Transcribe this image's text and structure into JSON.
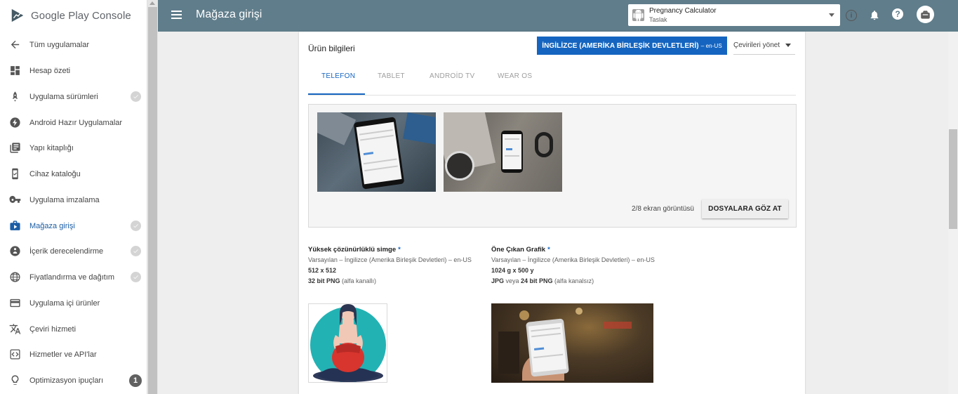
{
  "brand": {
    "name": "Google Play Console"
  },
  "sidebar": {
    "items": [
      {
        "label": "Tüm uygulamalar",
        "icon": "arrow-left-icon",
        "state": "none"
      },
      {
        "label": "Hesap özeti",
        "icon": "dashboard-icon",
        "state": "none"
      },
      {
        "label": "Uygulama sürümleri",
        "icon": "rocket-icon",
        "state": "check"
      },
      {
        "label": "Android Hazır Uygulamalar",
        "icon": "bolt-icon",
        "state": "none"
      },
      {
        "label": "Yapı kitaplığı",
        "icon": "library-icon",
        "state": "none"
      },
      {
        "label": "Cihaz kataloğu",
        "icon": "device-icon",
        "state": "none"
      },
      {
        "label": "Uygulama imzalama",
        "icon": "key-icon",
        "state": "none"
      },
      {
        "label": "Mağaza girişi",
        "icon": "store-icon",
        "state": "check",
        "active": true
      },
      {
        "label": "İçerik derecelendirme",
        "icon": "rating-icon",
        "state": "check"
      },
      {
        "label": "Fiyatlandırma ve dağıtım",
        "icon": "globe-icon",
        "state": "check"
      },
      {
        "label": "Uygulama içi ürünler",
        "icon": "card-icon",
        "state": "none"
      },
      {
        "label": "Çeviri hizmeti",
        "icon": "translate-icon",
        "state": "none"
      },
      {
        "label": "Hizmetler ve API'lar",
        "icon": "api-icon",
        "state": "none"
      },
      {
        "label": "Optimizasyon ipuçları",
        "icon": "lightbulb-icon",
        "state": "badge",
        "badge": "1"
      }
    ]
  },
  "header": {
    "title": "Mağaza girişi",
    "app_name": "Pregnancy Calculator",
    "app_status": "Taslak",
    "info_symbol": "i",
    "help_symbol": "?"
  },
  "card": {
    "title": "Ürün bilgileri",
    "language_button": "İNGİLİZCE (AMERİKA BİRLEŞİK DEVLETLERİ)",
    "language_code": "– en-US",
    "translations_select": "Çevirileri yönet",
    "tabs": [
      "TELEFON",
      "TABLET",
      "ANDROİD TV",
      "WEAR OS"
    ],
    "active_tab": 0,
    "screenshot_count": "2/8 ekran görüntüsü",
    "browse_button": "DOSYALARA GÖZ AT"
  },
  "assets": {
    "icon": {
      "title": "Yüksek çözünürlüklü simge",
      "required_mark": "*",
      "language": "Varsayılan – İngilizce (Amerika Birleşik Devletleri) – en-US",
      "size": "512 x 512",
      "format_bold": "32 bit PNG",
      "format_rest": " (alfa kanallı)"
    },
    "feature": {
      "title": "Öne Çıkan Grafik",
      "required_mark": "*",
      "language": "Varsayılan – İngilizce (Amerika Birleşik Devletleri) – en-US",
      "size": "1024 g x 500 y",
      "format_a": "JPG",
      "format_mid": " veya ",
      "format_b": "24 bit PNG",
      "format_rest": " (alfa kanalsız)"
    }
  },
  "colors": {
    "header_bg": "#607d8b",
    "accent": "#1565c0",
    "active_nav": "#1a5da5"
  }
}
